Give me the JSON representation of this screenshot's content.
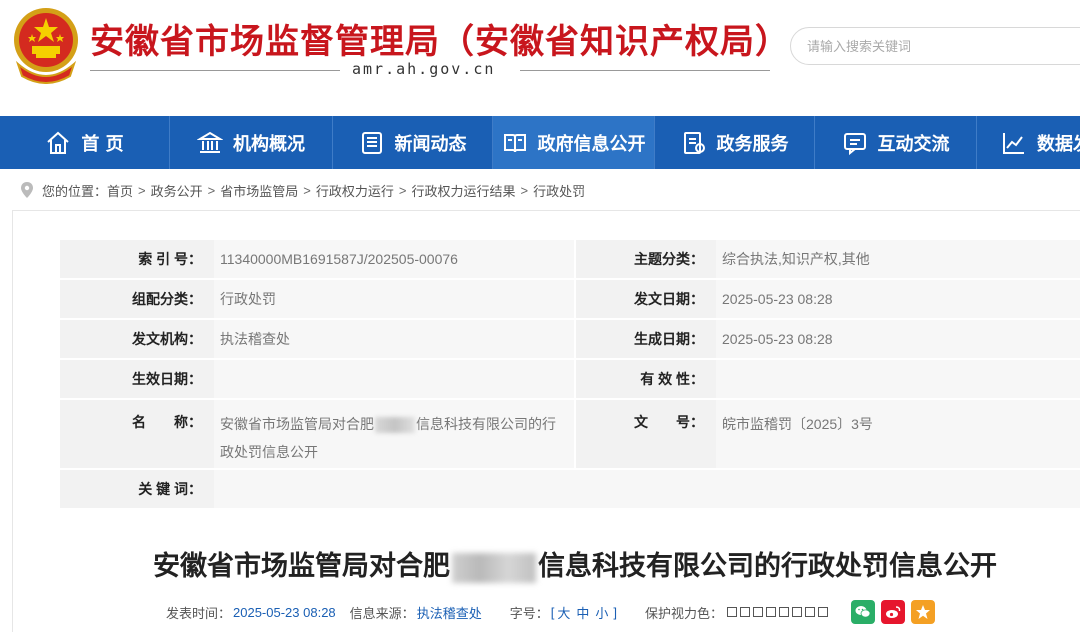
{
  "header": {
    "site_title": "安徽省市场监督管理局（安徽省知识产权局）",
    "domain": "amr.ah.gov.cn",
    "search_placeholder": "请输入搜索关键词"
  },
  "nav": {
    "items": [
      {
        "label": "首 页",
        "icon": "home-icon"
      },
      {
        "label": "机构概况",
        "icon": "building-icon"
      },
      {
        "label": "新闻动态",
        "icon": "newspaper-icon"
      },
      {
        "label": "政府信息公开",
        "icon": "book-icon"
      },
      {
        "label": "政务服务",
        "icon": "document-icon"
      },
      {
        "label": "互动交流",
        "icon": "chat-icon"
      },
      {
        "label": "数据发布",
        "icon": "chart-icon"
      }
    ],
    "active_index": 3
  },
  "breadcrumb": {
    "prefix": "您的位置：",
    "items": [
      "首页",
      "政务公开",
      "省市场监管局",
      "行政权力运行",
      "行政权力运行结果",
      "行政处罚"
    ],
    "separator": ">"
  },
  "meta": {
    "index_no_label": "索 引 号：",
    "index_no": "11340000MB1691587J/202505-00076",
    "topic_label": "主题分类：",
    "topic": "综合执法,知识产权,其他",
    "category_label": "组配分类：",
    "category": "行政处罚",
    "issue_date_label": "发文日期：",
    "issue_date": "2025-05-23 08:28",
    "org_label": "发文机构：",
    "org": "执法稽查处",
    "gen_date_label": "生成日期：",
    "gen_date": "2025-05-23 08:28",
    "effective_label": "生效日期：",
    "effective": "",
    "validity_label": "有 效 性：",
    "validity": "",
    "name_label": "名　　称：",
    "name_part1": "安徽省市场监管局对合肥",
    "name_part2": "信息科技有限公司的行",
    "name_line2": "政处罚信息公开",
    "doc_no_label": "文　　号：",
    "doc_no": "皖市监稽罚〔2025〕3号",
    "keywords_label": "关 键 词：",
    "keywords": ""
  },
  "article": {
    "title_part1": "安徽省市场监管局对合肥",
    "title_part2": "信息科技有限公司的行政处罚信息公开",
    "publish_time_label": "发表时间：",
    "publish_time": "2025-05-23 08:28",
    "source_label": "信息来源：",
    "source": "执法稽查处",
    "font_size_label": "字号：",
    "font_open": "[",
    "font_large": "大",
    "font_medium": "中",
    "font_small": "小",
    "font_close": "]",
    "eye_label": "保护视力色："
  },
  "colors": {
    "brand_red": "#c8161d",
    "nav_blue": "#1a5fb4",
    "wechat_green": "#2aae67",
    "weibo_red": "#e6162d",
    "favorite_orange": "#f4a024"
  }
}
